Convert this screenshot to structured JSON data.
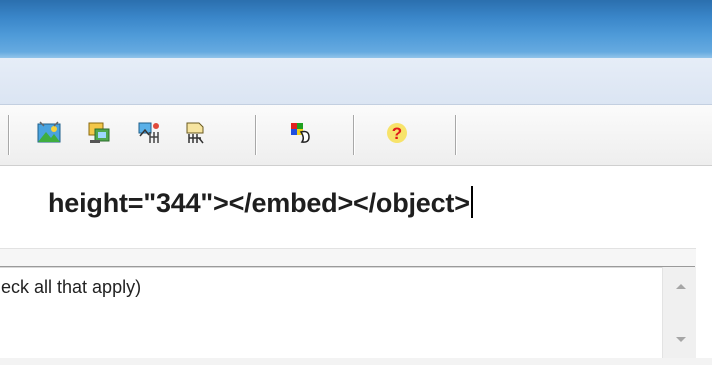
{
  "toolbar": {
    "buttons": [
      {
        "icon": "insert-image-icon"
      },
      {
        "icon": "insert-media-icon"
      },
      {
        "icon": "manage-files-icon"
      },
      {
        "icon": "file-properties-icon"
      },
      {
        "icon": "color-palette-icon"
      },
      {
        "icon": "help-icon",
        "glyph": "?"
      }
    ]
  },
  "code_field": {
    "value": "height=\"344\"></embed></object>"
  },
  "options_box": {
    "text": "eck all that apply)"
  },
  "colors": {
    "titlebar": "#3a86c9",
    "help_glyph": "#e01a1a",
    "help_bg": "#f7e36a"
  }
}
